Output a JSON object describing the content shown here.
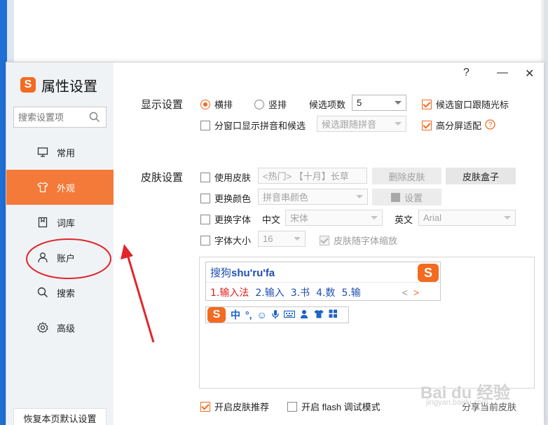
{
  "app": {
    "title": "属性设置",
    "help": "?",
    "minimize": "—",
    "close": "✕"
  },
  "sidebar": {
    "search_placeholder": "搜索设置项",
    "items": [
      {
        "label": "常用",
        "icon": "monitor-icon"
      },
      {
        "label": "外观",
        "icon": "shirt-icon",
        "active": true
      },
      {
        "label": "词库",
        "icon": "book-icon"
      },
      {
        "label": "账户",
        "icon": "user-icon"
      },
      {
        "label": "搜索",
        "icon": "search-icon"
      },
      {
        "label": "高级",
        "icon": "gear-icon"
      }
    ],
    "restore_label": "恢复本页默认设置"
  },
  "display": {
    "label": "显示设置",
    "horizontal": "横排",
    "vertical": "竖排",
    "cand_count_label": "候选项数",
    "cand_count_value": "5",
    "follow_cursor": "候选窗口跟随光标",
    "split_window": "分窗口显示拼音和候选",
    "split_select": "候选跟随拼音",
    "high_dpi": "高分屏适配"
  },
  "skin": {
    "label": "皮肤设置",
    "use_skin": "使用皮肤",
    "skin_select": "<热门> 【十月】长草",
    "delete_skin": "删除皮肤",
    "skin_box": "皮肤盒子",
    "change_color": "更换颜色",
    "color_select": "拼音串颜色",
    "color_setting": "设置",
    "change_font": "更换字体",
    "cn_label": "中文",
    "cn_font": "宋体",
    "en_label": "英文",
    "en_font": "Arial",
    "font_size": "字体大小",
    "font_size_value": "16",
    "scale_with_font": "皮肤随字体缩放"
  },
  "preview": {
    "pinyin_prefix": "搜狗",
    "pinyin": "shu'ru'fa",
    "candidates": [
      "1.输入法",
      "2.输入",
      "3.书",
      "4.数",
      "5.输"
    ],
    "prev": "<",
    "next": ">",
    "logo": "S",
    "status_icons": [
      "中",
      "°,",
      "☺",
      "🎤",
      "⌨",
      "👤",
      "👕",
      "▦"
    ]
  },
  "footer": {
    "recommend": "开启皮肤推荐",
    "flash_debug": "开启 flash 调试模式",
    "share_skin": "分享当前皮肤"
  },
  "watermark": {
    "main": "Bai du 经验",
    "sub": "jingyan.baidu.com"
  },
  "colors": {
    "accent": "#f26b21",
    "active_nav": "#f47a3a",
    "sidebar_bg": "#f0f3f6"
  }
}
